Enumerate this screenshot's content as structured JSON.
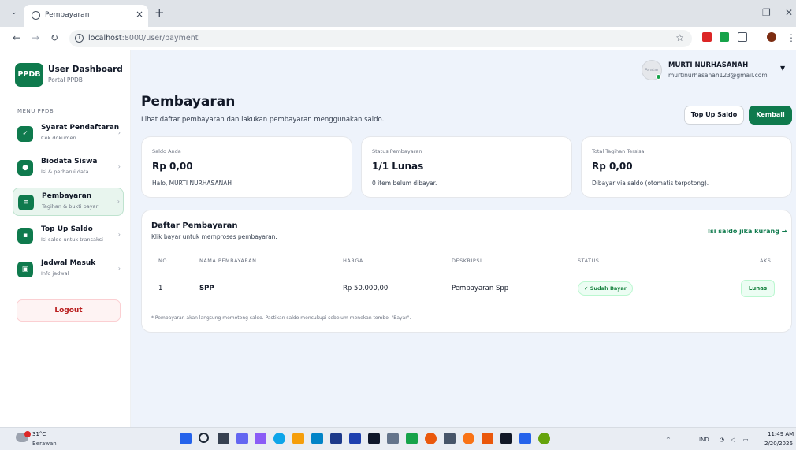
{
  "browser": {
    "tab_title": "Pembayaran",
    "url_host": "localhost",
    "url_rest": ":8000/user/payment"
  },
  "sidebar": {
    "brand_logo": "PPDB",
    "brand_title": "User Dashboard",
    "brand_subtitle": "Portal PPDB",
    "menu_label": "MENU PPDB",
    "items": [
      {
        "title": "Syarat Pendaftaran",
        "subtitle": "Cek dokumen",
        "icon": "check-icon"
      },
      {
        "title": "Biodata Siswa",
        "subtitle": "Isi & perbarui data",
        "icon": "user-icon"
      },
      {
        "title": "Pembayaran",
        "subtitle": "Tagihan & bukti bayar",
        "icon": "payment-icon"
      },
      {
        "title": "Top Up Saldo",
        "subtitle": "Isi saldo untuk transaksi",
        "icon": "wallet-icon"
      },
      {
        "title": "Jadwal Masuk",
        "subtitle": "Info jadwal",
        "icon": "calendar-icon"
      }
    ],
    "logout_label": "Logout"
  },
  "header": {
    "avatar_alt": "Avatar",
    "user_name": "MURTI NURHASANAH",
    "user_email": "murtinurhasanah123@gmail.com"
  },
  "page": {
    "title": "Pembayaran",
    "subtitle": "Lihat daftar pembayaran dan lakukan pembayaran menggunakan saldo.",
    "btn_topup": "Top Up Saldo",
    "btn_back": "Kembali"
  },
  "cards": [
    {
      "label": "Saldo Anda",
      "value": "Rp 0,00",
      "note": "Halo, MURTI NURHASANAH"
    },
    {
      "label": "Status Pembayaran",
      "value": "1/1 Lunas",
      "note": "0 item belum dibayar."
    },
    {
      "label": "Total Tagihan Tersisa",
      "value": "Rp 0,00",
      "note": "Dibayar via saldo (otomatis terpotong)."
    }
  ],
  "payments": {
    "title": "Daftar Pembayaran",
    "subtitle": "Klik bayar untuk memproses pembayaran.",
    "link": "Isi saldo jika kurang →",
    "columns": [
      "NO",
      "NAMA PEMBAYARAN",
      "HARGA",
      "DESKRIPSI",
      "STATUS",
      "AKSI"
    ],
    "rows": [
      {
        "no": "1",
        "name": "SPP",
        "price": "Rp 50.000,00",
        "description": "Pembayaran Spp",
        "status": "✓ Sudah Bayar",
        "action": "Lunas"
      }
    ],
    "footnote": "* Pembayaran akan langsung memotong saldo. Pastikan saldo mencukupi sebelum menekan tombol \"Bayar\"."
  },
  "taskbar": {
    "weather_temp": "31°C",
    "weather_desc": "Berawan",
    "lang": "IND",
    "time": "11:49 AM",
    "date": "2/20/2026"
  },
  "colors": {
    "brand_green": "#0f7a4d",
    "main_bg": "#eef3fb"
  }
}
